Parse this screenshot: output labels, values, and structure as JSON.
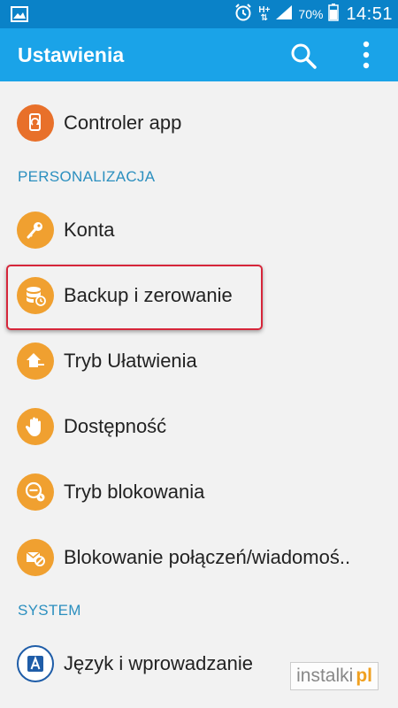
{
  "status_bar": {
    "network": "H+",
    "battery_percent": "70%",
    "time": "14:51"
  },
  "app_bar": {
    "title": "Ustawienia"
  },
  "items_top": [
    {
      "label": "Controler app",
      "icon": "phone-sync-icon",
      "color": "#e8702a"
    }
  ],
  "sections": {
    "personalization": "PERSONALIZACJA",
    "system": "SYSTEM"
  },
  "personalization_items": [
    {
      "label": "Konta",
      "icon": "key-icon",
      "color": "#f0a030"
    },
    {
      "label": "Backup i zerowanie",
      "icon": "backup-icon",
      "color": "#f0a030"
    },
    {
      "label": "Tryb Ułatwienia",
      "icon": "easy-mode-icon",
      "color": "#f0a030"
    },
    {
      "label": "Dostępność",
      "icon": "hand-icon",
      "color": "#f0a030"
    },
    {
      "label": "Tryb blokowania",
      "icon": "blocking-mode-icon",
      "color": "#f0a030"
    },
    {
      "label": "Blokowanie połączeń/wiadomoś..",
      "icon": "call-block-icon",
      "color": "#f0a030"
    }
  ],
  "system_items": [
    {
      "label": "Język i wprowadzanie",
      "icon": "language-icon",
      "color": "#1f5da8"
    }
  ],
  "watermark": {
    "text": "instalki",
    "suffix": "pl"
  }
}
